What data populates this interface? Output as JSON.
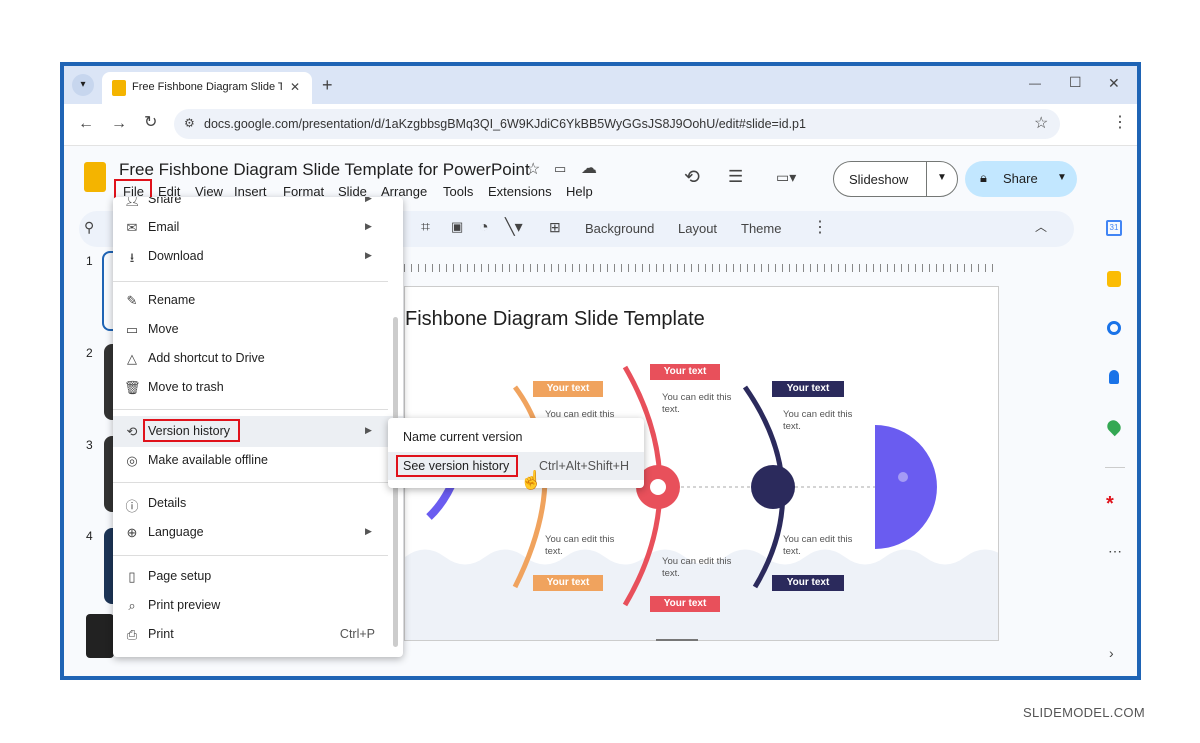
{
  "browser": {
    "tab_title": "Free Fishbone Diagram Slide Te",
    "url": "docs.google.com/presentation/d/1aKzgbbsgBMq3QI_6W9KJdiC6YkBB5WyGGsJS8J9OohU/edit#slide=id.p1",
    "new_tab": "+",
    "win_min": "—",
    "win_max": "☐",
    "win_close": "✕"
  },
  "app": {
    "doc_title": "Free Fishbone Diagram Slide Template for PowerPoint",
    "menus": [
      "File",
      "Edit",
      "View",
      "Insert",
      "Format",
      "Slide",
      "Arrange",
      "Tools",
      "Extensions",
      "Help"
    ],
    "slideshow_label": "Slideshow",
    "share_label": "Share",
    "edit_toolbar": {
      "background": "Background",
      "layout": "Layout",
      "theme": "Theme"
    },
    "slide_numbers": [
      "1",
      "2",
      "3",
      "4"
    ]
  },
  "slide": {
    "title": "Fishbone Diagram Slide Template",
    "your_text": "Your text",
    "body": "You can edit this text."
  },
  "file_menu": {
    "share": "Share",
    "email": "Email",
    "download": "Download",
    "rename": "Rename",
    "move": "Move",
    "shortcut": "Add shortcut to Drive",
    "trash": "Move to trash",
    "version_history": "Version history",
    "offline": "Make available offline",
    "details": "Details",
    "language": "Language",
    "page_setup": "Page setup",
    "print_preview": "Print preview",
    "print": "Print",
    "print_shortcut": "Ctrl+P"
  },
  "submenu": {
    "name_version": "Name current version",
    "see_history": "See version history",
    "see_shortcut": "Ctrl+Alt+Shift+H"
  },
  "colors": {
    "orange": "#f0a35e",
    "red": "#e8505b",
    "navy": "#2b2a5c",
    "purple": "#6a5cf0",
    "blue": "#1f64b5"
  },
  "watermark": "SLIDEMODEL.COM"
}
